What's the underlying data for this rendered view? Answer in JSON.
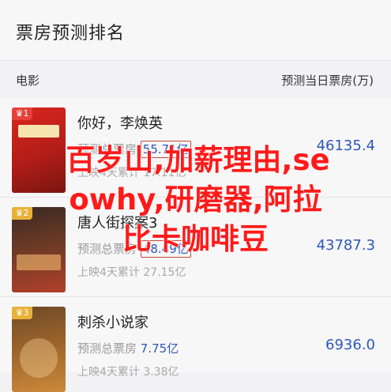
{
  "header": {
    "title": "票房预测排名"
  },
  "columns": {
    "left": "电影",
    "right": "预测当日票房(万)"
  },
  "movies": [
    {
      "rank": "1",
      "title": "你好，李焕英",
      "pred_label": "预测总票房",
      "pred_value": "55.71亿",
      "cum_label": "上映4天累计",
      "cum_value": "17.11亿",
      "today": "46135.4"
    },
    {
      "rank": "2",
      "title": "唐人街探案3",
      "pred_label": "预测总票房",
      "pred_value": "48.49亿",
      "cum_label": "上映4天累计",
      "cum_value": "27.15亿",
      "today": "43787.3"
    },
    {
      "rank": "3",
      "title": "刺杀小说家",
      "pred_label": "预测总票房",
      "pred_value": "7.75亿",
      "cum_label": "上映4天累计",
      "cum_value": "3.38亿",
      "today": "6936.0"
    }
  ],
  "overlay": {
    "line1": "百岁山,加薪理由,se",
    "line2": "owhy,研磨器,阿拉",
    "line3": "比卡咖啡豆"
  }
}
